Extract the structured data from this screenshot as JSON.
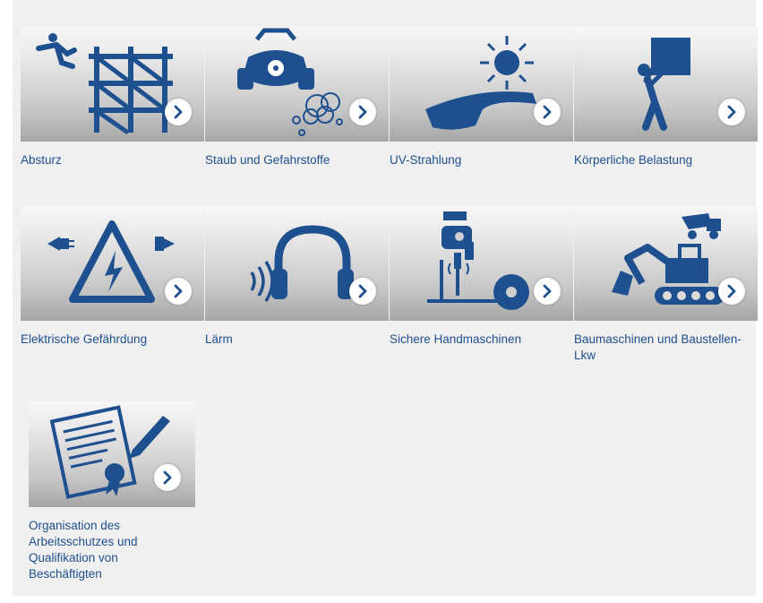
{
  "tiles": [
    {
      "label": "Absturz",
      "icon": "fall-scaffold-icon"
    },
    {
      "label": "Staub und Gefahrstoffe",
      "icon": "respirator-dust-icon"
    },
    {
      "label": "UV-Strahlung",
      "icon": "sun-sunglasses-icon"
    },
    {
      "label": "Körperliche Belastung",
      "icon": "person-carrying-box-icon"
    },
    {
      "label": "Elektrische Gefährdung",
      "icon": "electric-hazard-icon"
    },
    {
      "label": "Lärm",
      "icon": "ear-protection-icon"
    },
    {
      "label": "Sichere Handmaschinen",
      "icon": "power-tools-icon"
    },
    {
      "label": "Baumaschinen und Baustellen-Lkw",
      "icon": "excavator-truck-icon"
    },
    {
      "label": "Organisation des Arbeitsschutzes und Qualifikation von Beschäftigten",
      "icon": "certificate-pen-icon"
    }
  ],
  "colors": {
    "icon": "#1e4f8e",
    "text": "#1e4f8e",
    "panel": "#f0f0f0"
  }
}
